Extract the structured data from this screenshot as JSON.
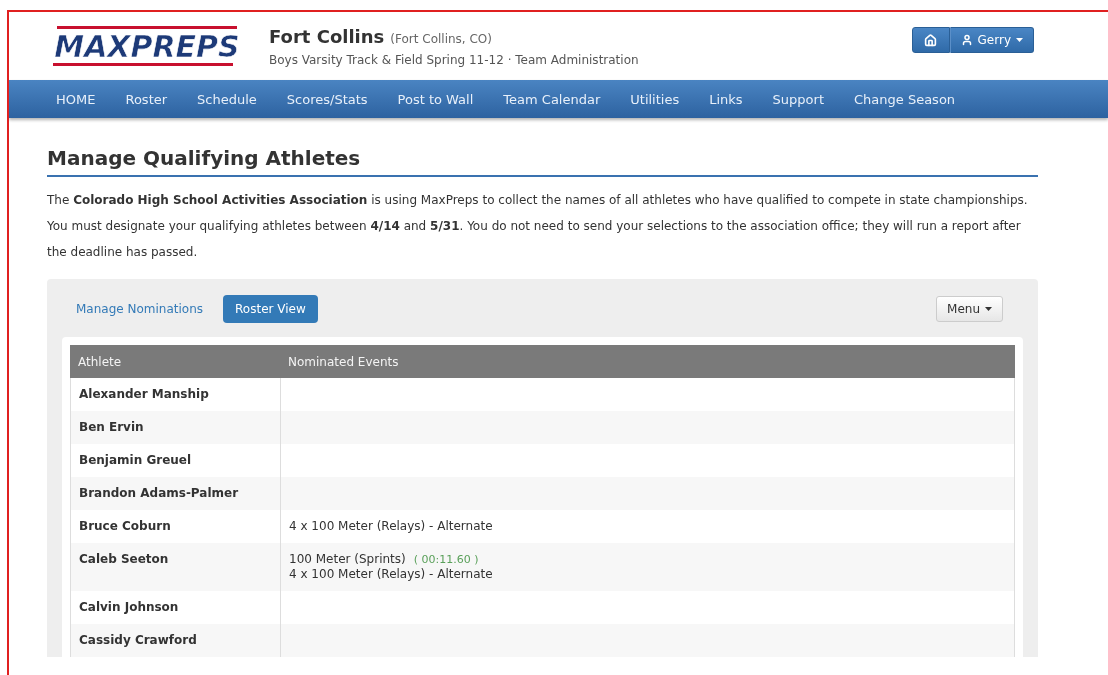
{
  "header": {
    "logo": "MAXPREPS",
    "team": "Fort Collins",
    "location": "(Fort Collins, CO)",
    "subtitle": "Boys Varsity Track & Field Spring 11-12 · Team Administration",
    "user": "Gerry"
  },
  "nav": [
    "HOME",
    "Roster",
    "Schedule",
    "Scores/Stats",
    "Post to Wall",
    "Team Calendar",
    "Utilities",
    "Links",
    "Support",
    "Change Season"
  ],
  "page": {
    "title": "Manage Qualifying Athletes",
    "intro": "The **Colorado High School Activities Association** is using MaxPreps to collect the names of all athletes who have qualified to compete in state championships. You must designate your qualifying athletes between **4/14** and **5/31**. You do not need to send your selections to the association office; they will run a report after the deadline has passed."
  },
  "tabs": [
    {
      "label": "Manage Nominations",
      "selected": false
    },
    {
      "label": "Roster View",
      "selected": true
    }
  ],
  "menu_button": "Menu",
  "table": {
    "columns": [
      "Athlete",
      "Nominated Events"
    ],
    "rows": [
      {
        "athlete": "Alexander Manship",
        "events": []
      },
      {
        "athlete": "Ben Ervin",
        "events": []
      },
      {
        "athlete": "Benjamin Greuel",
        "events": []
      },
      {
        "athlete": "Brandon Adams-Palmer",
        "events": []
      },
      {
        "athlete": "Bruce Coburn",
        "events": [
          {
            "name": "4 x 100 Meter (Relays) - Alternate"
          }
        ]
      },
      {
        "athlete": "Caleb Seeton",
        "events": [
          {
            "name": "100 Meter (Sprints)",
            "time": "( 00:11.60 )"
          },
          {
            "name": "4 x 100 Meter (Relays) - Alternate"
          }
        ]
      },
      {
        "athlete": "Calvin Johnson",
        "events": []
      },
      {
        "athlete": "Cassidy Crawford",
        "events": []
      }
    ]
  }
}
